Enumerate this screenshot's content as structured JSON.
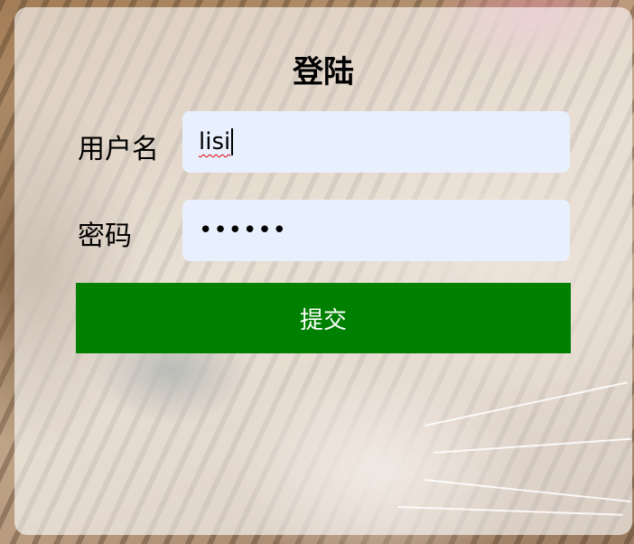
{
  "form": {
    "title": "登陆",
    "username_label": "用户名",
    "username_value": "lisi",
    "password_label": "密码",
    "password_value": "••••••",
    "submit_label": "提交"
  },
  "colors": {
    "submit_background": "#008000",
    "input_background": "#e8f0fe",
    "card_overlay": "rgba(255,255,255,0.62)"
  }
}
